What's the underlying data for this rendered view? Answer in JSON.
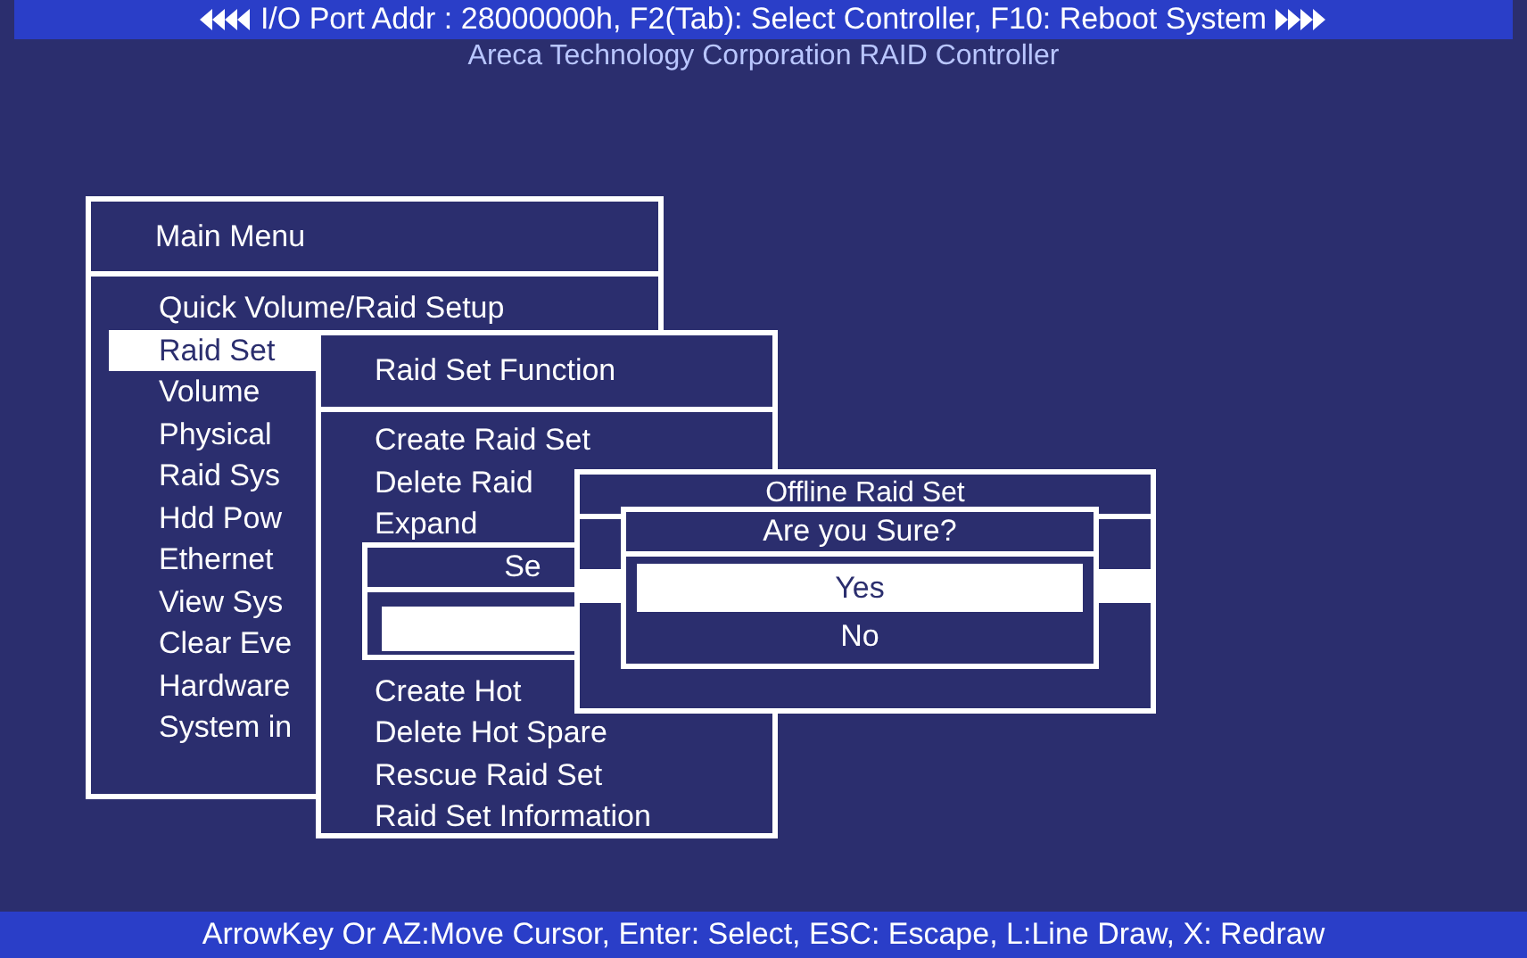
{
  "header": {
    "status_line": "I/O Port Addr : 28000000h, F2(Tab): Select Controller, F10: Reboot System",
    "title": "Areca Technology Corporation RAID Controller"
  },
  "windows": [
    {
      "title": "Main Menu",
      "items": [
        {
          "label": "Quick Volume/Raid Setup",
          "selected": false
        },
        {
          "label": "Raid Set",
          "selected": true
        },
        {
          "label": "Volume",
          "selected": false
        },
        {
          "label": "Physical",
          "selected": false
        },
        {
          "label": "Raid Sys",
          "selected": false
        },
        {
          "label": "Hdd Pow",
          "selected": false
        },
        {
          "label": "Ethernet",
          "selected": false
        },
        {
          "label": "View Sys",
          "selected": false
        },
        {
          "label": "Clear Eve",
          "selected": false
        },
        {
          "label": "Hardware",
          "selected": false
        },
        {
          "label": "System in",
          "selected": false
        }
      ]
    },
    {
      "title": "Raid Set Function",
      "items": [
        {
          "label": "Create Raid Set",
          "selected": false
        },
        {
          "label": "Delete Raid",
          "selected": false
        },
        {
          "label": "Expand",
          "selected": false
        },
        {
          "label": "Create Hot",
          "selected": false
        },
        {
          "label": "Delete Hot Spare",
          "selected": false
        },
        {
          "label": "Rescue Raid Set",
          "selected": false
        },
        {
          "label": "Raid Set Information",
          "selected": false
        }
      ]
    },
    {
      "title": "Se",
      "items": [
        {
          "selected": true
        }
      ]
    },
    {
      "title": "Offline Raid Set",
      "items": [
        {
          "selected": true
        }
      ]
    },
    {
      "title": "Are you Sure?",
      "items": [
        {
          "label": "Yes",
          "selected": true
        },
        {
          "label": "No",
          "selected": false
        }
      ]
    }
  ],
  "status_bar": "ArrowKey Or AZ:Move Cursor, Enter: Select, ESC: Escape, L:Line Draw, X: Redraw"
}
